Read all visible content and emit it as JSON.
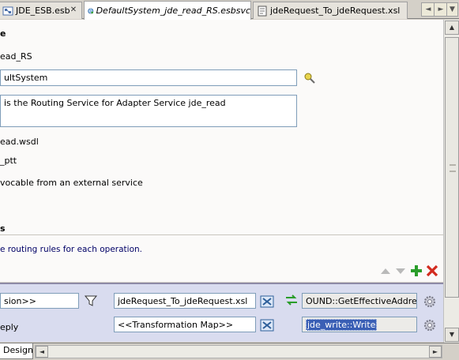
{
  "tabs": [
    {
      "label": "JDE_ESB.esb",
      "italic": false,
      "active": false
    },
    {
      "label": "DefaultSystem_jde_read_RS.esbsvc",
      "italic": true,
      "active": true
    },
    {
      "label": "jdeRequest_To_jdeRequest.xsl",
      "italic": false,
      "active": false
    }
  ],
  "tab_nav": {
    "left": "◄",
    "right": "►",
    "menu": "▼"
  },
  "editor": {
    "heading_tail": "e",
    "name_value": "ead_RS",
    "system_value": "ultSystem",
    "description_value": "is the Routing Service for Adapter Service jde_read",
    "wsdl_value": "ead.wsdl",
    "port_type_value": "_ptt",
    "invocable_label": "vocable from an external service",
    "section_title": "s",
    "hint": "e routing rules for each operation."
  },
  "routing_rule": {
    "filter_value": "sion>>",
    "transform_value": "jdeRequest_To_jdeRequest.xsl",
    "target_value": "OUND::GetEffectiveAddress",
    "reply_label": "eply",
    "reply_transform_value": "<<Transformation Map>>",
    "reply_target_value": "jde_write::Write"
  },
  "bottom": {
    "design_tab": "Design"
  },
  "colors": {
    "accent_green": "#2a9d2a",
    "delete_red": "#d22a1e",
    "selection": "#3a5fb5",
    "rule_panel": "#d9dcef"
  }
}
